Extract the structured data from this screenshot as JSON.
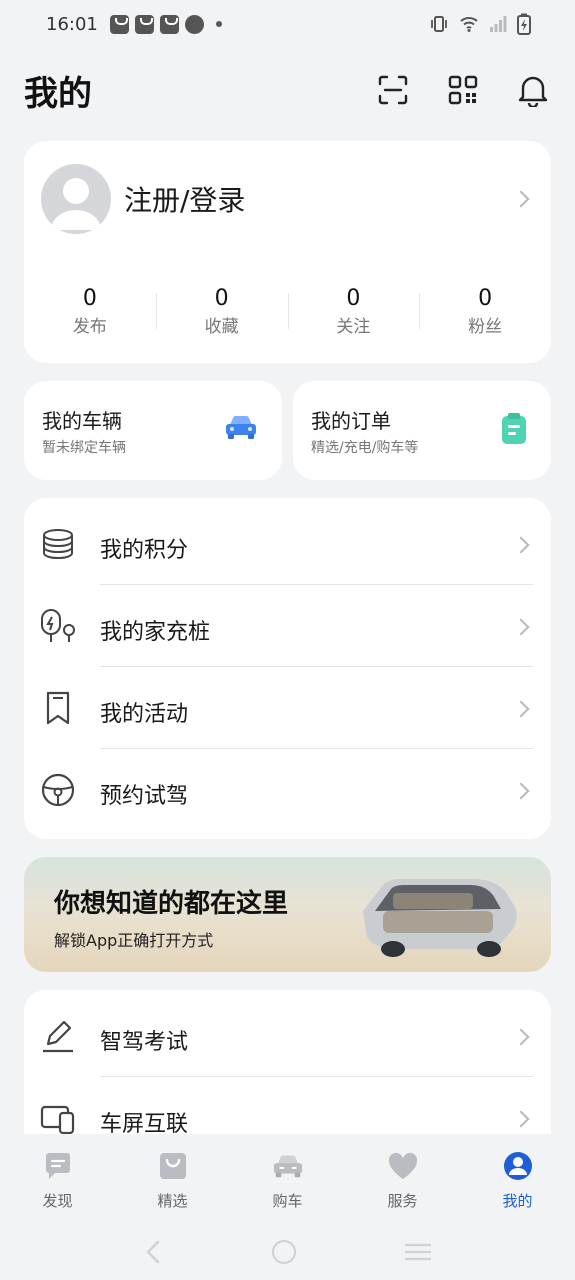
{
  "status_bar": {
    "time": "16:01"
  },
  "header": {
    "title": "我的"
  },
  "profile": {
    "login_label": "注册/登录"
  },
  "stats": [
    {
      "value": "0",
      "label": "发布"
    },
    {
      "value": "0",
      "label": "收藏"
    },
    {
      "value": "0",
      "label": "关注"
    },
    {
      "value": "0",
      "label": "粉丝"
    }
  ],
  "vehicle_card": {
    "title": "我的车辆",
    "subtitle": "暂未绑定车辆"
  },
  "order_card": {
    "title": "我的订单",
    "subtitle": "精选/充电/购车等"
  },
  "menu": [
    {
      "label": "我的积分",
      "icon": "coins-stack-icon"
    },
    {
      "label": "我的家充桩",
      "icon": "charging-pile-icon"
    },
    {
      "label": "我的活动",
      "icon": "bookmark-icon"
    },
    {
      "label": "预约试驾",
      "icon": "steering-wheel-icon"
    }
  ],
  "banner": {
    "title": "你想知道的都在这里",
    "subtitle": "解锁App正确打开方式"
  },
  "menu2": [
    {
      "label": "智驾考试",
      "icon": "edit-pencil-icon"
    },
    {
      "label": "车屏互联",
      "icon": "screen-link-icon"
    }
  ],
  "tabs": [
    {
      "label": "发现",
      "icon": "chat-bubble-icon",
      "active": false
    },
    {
      "label": "精选",
      "icon": "shopping-bag-icon",
      "active": false
    },
    {
      "label": "购车",
      "icon": "car-icon",
      "active": false
    },
    {
      "label": "服务",
      "icon": "heart-icon",
      "active": false
    },
    {
      "label": "我的",
      "icon": "user-icon",
      "active": true
    }
  ],
  "colors": {
    "accent": "#1f5fd6",
    "background": "#f1f3f5",
    "card": "#ffffff"
  }
}
